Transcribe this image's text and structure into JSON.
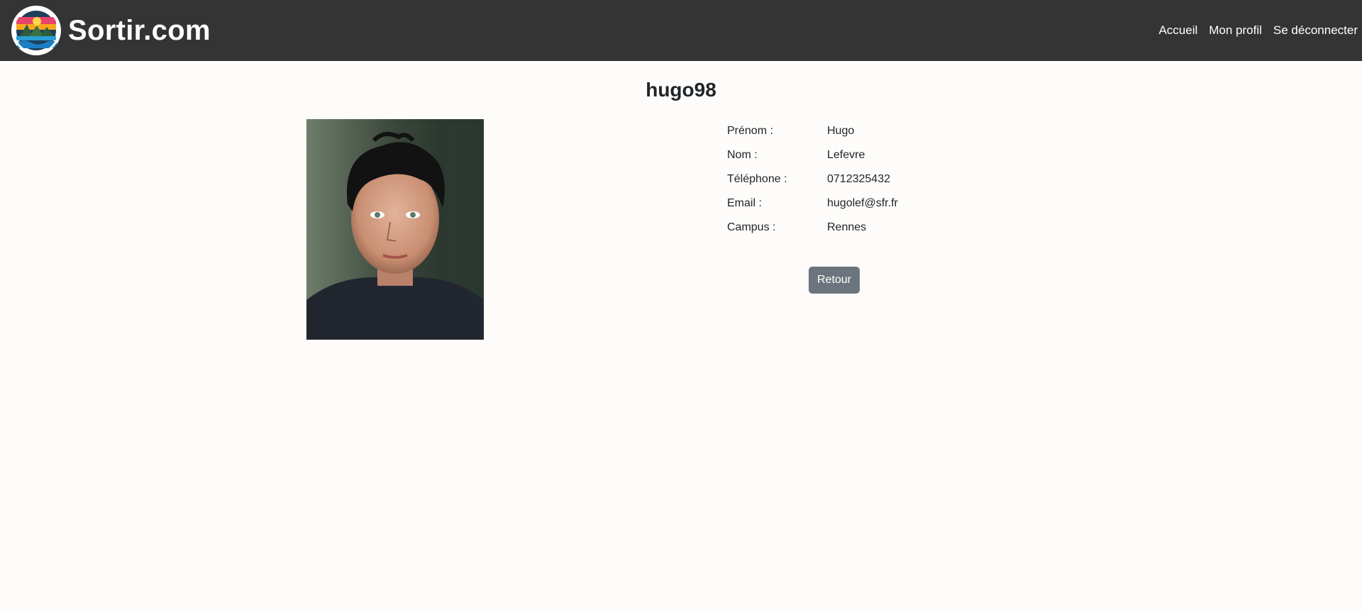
{
  "header": {
    "brand_name": "Sortir.com",
    "logo_icon": "sortir-logo",
    "nav": [
      {
        "label": "Accueil"
      },
      {
        "label": "Mon profil"
      },
      {
        "label": "Se déconnecter"
      }
    ],
    "background_color": "#343434"
  },
  "profile": {
    "username": "hugo98",
    "photo_icon": "profile-photo",
    "fields": [
      {
        "label": "Prénom :",
        "value": "Hugo"
      },
      {
        "label": "Nom :",
        "value": "Lefevre"
      },
      {
        "label": "Téléphone :",
        "value": "0712325432"
      },
      {
        "label": "Email :",
        "value": "hugolef@sfr.fr"
      },
      {
        "label": "Campus :",
        "value": "Rennes"
      }
    ],
    "back_button_label": "Retour"
  },
  "colors": {
    "page_background": "#fdfcfa",
    "button_secondary": "#6c757d"
  }
}
